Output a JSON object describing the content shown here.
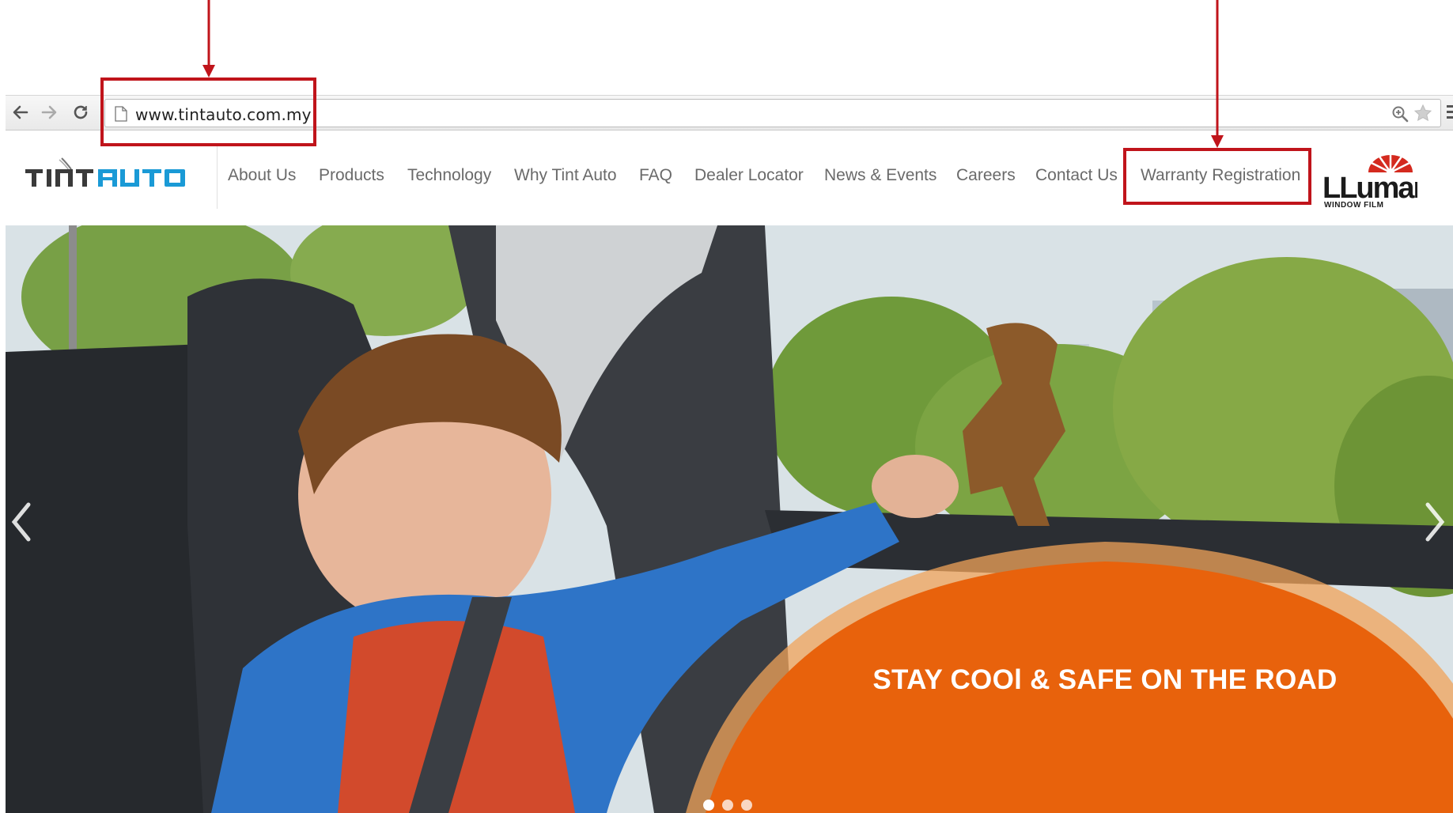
{
  "browser": {
    "url": "www.tintauto.com.my",
    "icons": [
      "back-arrow-icon",
      "forward-arrow-icon",
      "reload-icon",
      "page-icon",
      "zoom-icon",
      "bookmark-star-icon",
      "menu-icon"
    ]
  },
  "header": {
    "nav": [
      "About Us",
      "Products",
      "Technology",
      "Why Tint Auto",
      "FAQ",
      "Dealer Locator",
      "News & Events",
      "Careers",
      "Contact Us",
      "Warranty Registration"
    ],
    "brand_logo_text": "TINTAUTO",
    "partner_logo_text": "LLumar",
    "partner_logo_subtext": "WINDOW FILM"
  },
  "hero": {
    "tagline": "STAY COOl & SAFE ON THE ROAD",
    "slide_count": 3,
    "active_slide": 1
  },
  "annotations": {
    "color": "#c0141b",
    "targets": [
      "address-bar",
      "nav-warranty-registration"
    ]
  },
  "colors": {
    "accent_orange": "#e8620c",
    "brand_blue": "#1a9ad6",
    "annotation_red": "#c0141b"
  }
}
